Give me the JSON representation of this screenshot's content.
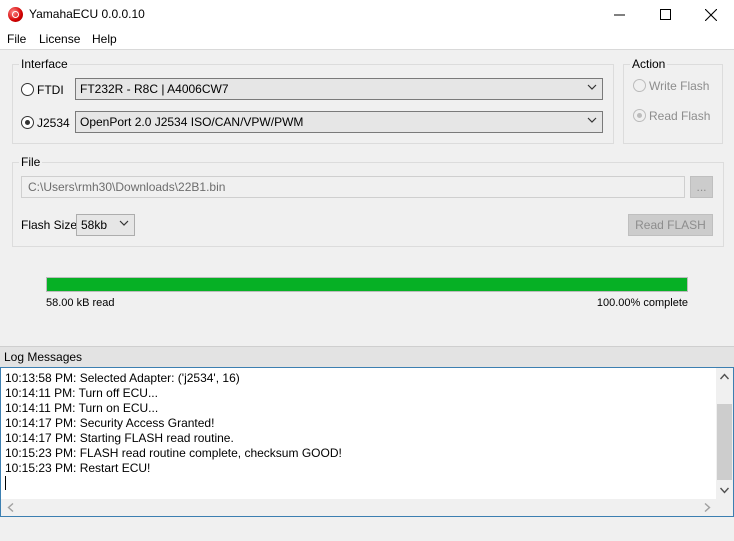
{
  "window": {
    "title": "YamahaECU 0.0.0.10",
    "minimize": "—",
    "maximize": "☐",
    "close": "✕"
  },
  "menu": [
    "File",
    "License",
    "Help"
  ],
  "interface": {
    "title": "Interface",
    "options": [
      {
        "label": "FTDI",
        "selected": false,
        "device": "FT232R - R8C | A4006CW7"
      },
      {
        "label": "J2534",
        "selected": true,
        "device": "OpenPort 2.0 J2534 ISO/CAN/VPW/PWM"
      }
    ]
  },
  "action": {
    "title": "Action",
    "write_label": "Write Flash",
    "read_label": "Read Flash",
    "selected": "Read Flash"
  },
  "file": {
    "title": "File",
    "path": "C:\\Users\\rmh30\\Downloads\\22B1.bin",
    "browse_label": "...",
    "flash_size_label": "Flash Size",
    "flash_size_value": "58kb",
    "read_button_label": "Read FLASH"
  },
  "progress": {
    "value": 1.0,
    "left_text": "58.00 kB read",
    "right_text": "100.00% complete"
  },
  "log": {
    "title": "Log Messages",
    "lines": [
      "10:13:58 PM: Selected Adapter: ('j2534', 16)",
      "10:14:11 PM: Turn off ECU...",
      "10:14:11 PM: Turn on ECU...",
      "10:14:17 PM: Security Access Granted!",
      "10:14:17 PM: Starting FLASH read routine.",
      "10:15:23 PM: FLASH read routine complete, checksum GOOD!",
      "10:15:23 PM: Restart ECU!"
    ]
  },
  "colors": {
    "progress_fill": "#06b025",
    "log_border": "#3c7fb1"
  }
}
